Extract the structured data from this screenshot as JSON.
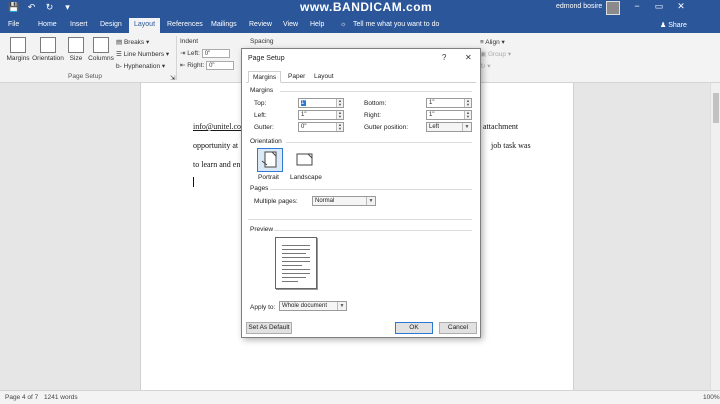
{
  "titlebar": {
    "watermark": "www.BANDICAM.com",
    "user_name": "edmond bosire",
    "window_controls": [
      "−",
      "▭",
      "✕"
    ],
    "qat_icons": [
      "save-icon",
      "undo-icon",
      "redo-icon",
      "customize-icon"
    ]
  },
  "tabs": [
    "File",
    "Home",
    "Insert",
    "Design",
    "Layout",
    "References",
    "Mailings",
    "Review",
    "View",
    "Help"
  ],
  "active_tab": "Layout",
  "tell_me": "Tell me what you want to do",
  "share_label": "Share",
  "ribbon": {
    "margins": "Margins",
    "orientation": "Orientation",
    "size": "Size",
    "columns": "Columns",
    "breaks": "Breaks",
    "line_numbers": "Line Numbers",
    "hyphenation": "Hyphenation",
    "group_page_setup": "Page Setup",
    "indent_label": "Indent",
    "left_label": "Left:",
    "right_label": "Right:",
    "indent_left": "0\"",
    "indent_right": "0\"",
    "spacing_label": "Spacing",
    "align": "Align",
    "group": "Group"
  },
  "document": {
    "line1_start": "info@unitel.co",
    "line1_end": "attachment",
    "line2_start": "opportunity at",
    "line2_end": "job task was",
    "line3_start": "to learn and en"
  },
  "statusbar": {
    "page": "Page 4 of 7",
    "words": "1241 words",
    "zoom": "100%"
  },
  "dialog": {
    "title": "Page Setup",
    "help": "?",
    "close": "✕",
    "tabs": [
      "Margins",
      "Paper",
      "Layout"
    ],
    "active_tab": "Margins",
    "margins_section": "Margins",
    "top_label": "Top:",
    "top_value": "1\"",
    "bottom_label": "Bottom:",
    "bottom_value": "1\"",
    "left_label": "Left:",
    "left_value": "1\"",
    "right_label": "Right:",
    "right_value": "1\"",
    "gutter_label": "Gutter:",
    "gutter_value": "0\"",
    "gutter_pos_label": "Gutter position:",
    "gutter_pos_value": "Left",
    "orientation_section": "Orientation",
    "portrait": "Portrait",
    "landscape": "Landscape",
    "selected_orientation": "Portrait",
    "pages_section": "Pages",
    "multiple_pages_label": "Multiple pages:",
    "multiple_pages_value": "Normal",
    "preview_section": "Preview",
    "apply_to_label": "Apply to:",
    "apply_to_value": "Whole document",
    "set_default": "Set As Default",
    "ok": "OK",
    "cancel": "Cancel"
  },
  "colors": {
    "accent": "#2b579a",
    "selection": "#2b79d4"
  }
}
